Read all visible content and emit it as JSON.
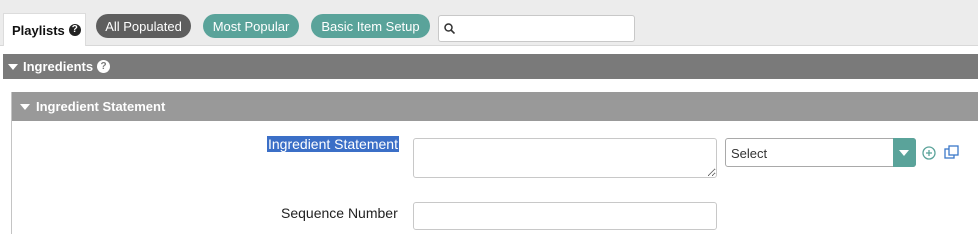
{
  "playlists": {
    "tab_label": "Playlists",
    "help_glyph": "?",
    "pills": [
      {
        "label": "All Populated",
        "style": "dark"
      },
      {
        "label": "Most Popular",
        "style": "teal"
      },
      {
        "label": "Basic Item Setup",
        "style": "teal"
      }
    ],
    "search": {
      "value": "",
      "placeholder": ""
    }
  },
  "ingredients": {
    "title": "Ingredients",
    "help_glyph": "?",
    "statement_section": {
      "title": "Ingredient Statement",
      "fields": {
        "statement_label": "Ingredient Statement",
        "statement_value": "",
        "select_value": "Select",
        "sequence_label": "Sequence Number",
        "sequence_value": ""
      }
    }
  },
  "colors": {
    "accent_teal": "#5aa39a",
    "pill_dark": "#5e5e5e",
    "header_dark": "#7a7a7a",
    "header_light": "#999999",
    "selection": "#3b6fc7",
    "icon_green": "#5aa39a",
    "icon_blue": "#3b78c9"
  },
  "icons": [
    "help-icon",
    "search-icon",
    "collapse-triangle-icon",
    "chevron-down-icon",
    "add-circle-icon",
    "copy-icon",
    "resize-grip-icon"
  ]
}
